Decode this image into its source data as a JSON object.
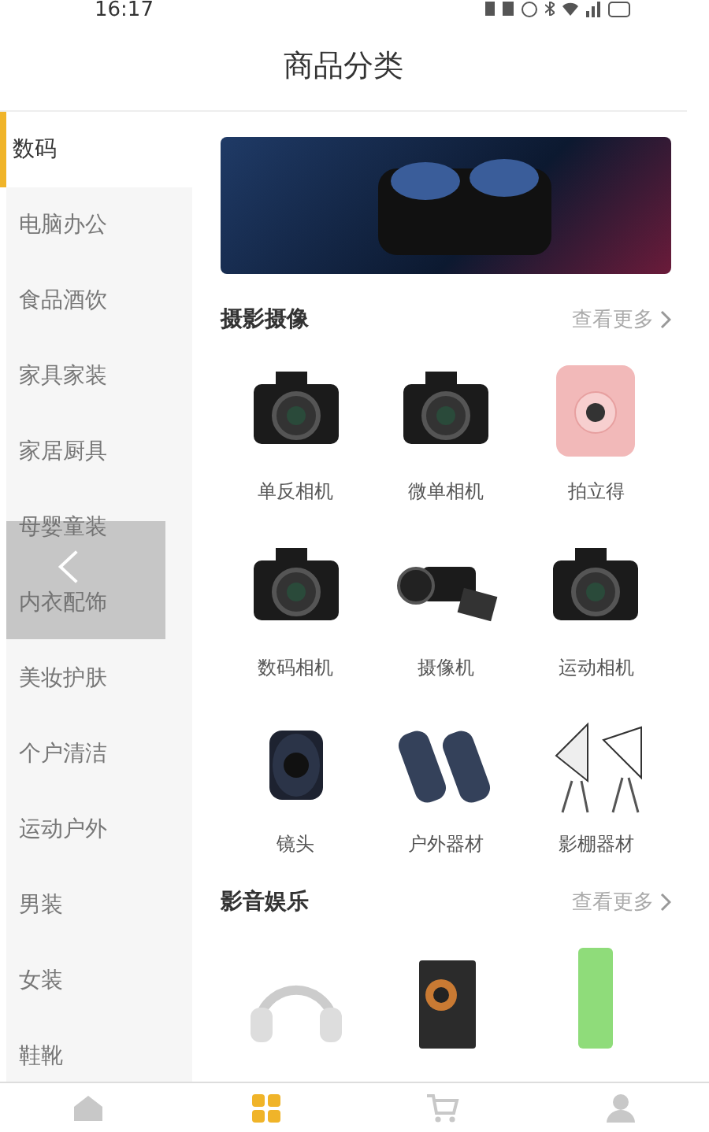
{
  "status_bar": {
    "time": "16:17"
  },
  "header": {
    "title": "商品分类"
  },
  "sidebar": {
    "items": [
      {
        "label": "数码",
        "selected": true
      },
      {
        "label": "电脑办公",
        "selected": false
      },
      {
        "label": "食品酒饮",
        "selected": false
      },
      {
        "label": "家具家装",
        "selected": false
      },
      {
        "label": "家居厨具",
        "selected": false
      },
      {
        "label": "母婴童装",
        "selected": false
      },
      {
        "label": "内衣配饰",
        "selected": false
      },
      {
        "label": "美妆护肤",
        "selected": false
      },
      {
        "label": "个户清洁",
        "selected": false
      },
      {
        "label": "运动户外",
        "selected": false
      },
      {
        "label": "男装",
        "selected": false
      },
      {
        "label": "女装",
        "selected": false
      },
      {
        "label": "鞋靴",
        "selected": false
      }
    ]
  },
  "sections": [
    {
      "title": "摄影摄像",
      "more": "查看更多",
      "products": [
        {
          "name": "单反相机",
          "kind": "camera"
        },
        {
          "name": "微单相机",
          "kind": "camera"
        },
        {
          "name": "拍立得",
          "kind": "instant"
        },
        {
          "name": "数码相机",
          "kind": "camera"
        },
        {
          "name": "摄像机",
          "kind": "camcorder"
        },
        {
          "name": "运动相机",
          "kind": "camera"
        },
        {
          "name": "镜头",
          "kind": "lens"
        },
        {
          "name": "户外器材",
          "kind": "binoculars"
        },
        {
          "name": "影棚器材",
          "kind": "lights"
        }
      ]
    },
    {
      "title": "影音娱乐",
      "more": "查看更多",
      "products": [
        {
          "kind": "headphones"
        },
        {
          "kind": "speaker"
        },
        {
          "kind": "player"
        }
      ]
    }
  ],
  "tab_bar": {
    "items": [
      {
        "kind": "home",
        "selected": false
      },
      {
        "kind": "category",
        "selected": true
      },
      {
        "kind": "cart",
        "selected": false
      },
      {
        "kind": "user",
        "selected": false
      }
    ]
  }
}
